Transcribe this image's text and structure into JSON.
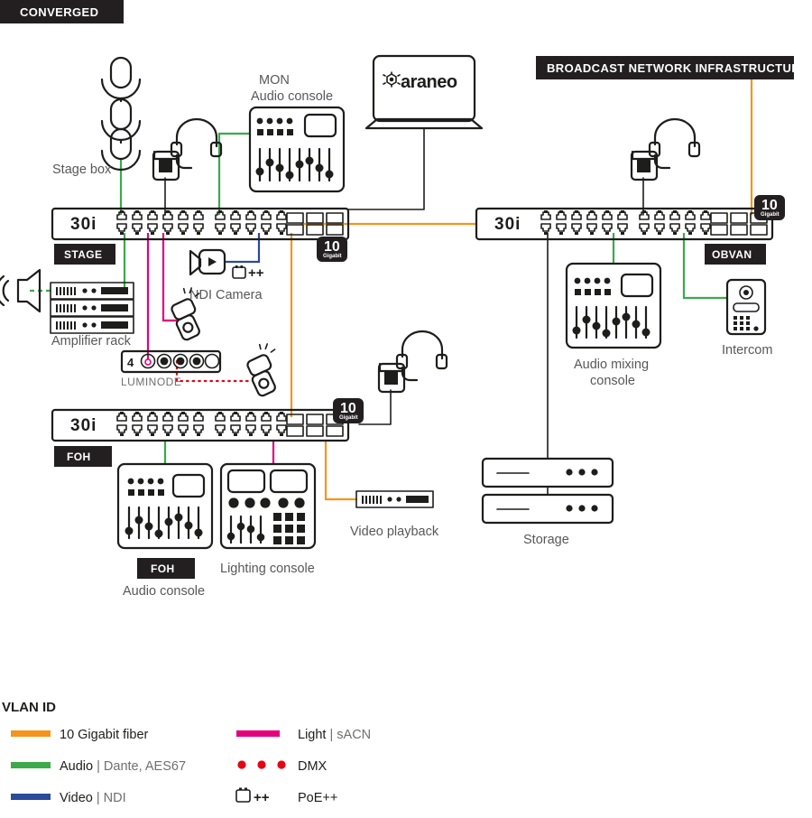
{
  "title_tags": {
    "converged": "CONVERGED",
    "broadcast": "BROADCAST NETWORK INFRASTRUCTURE"
  },
  "switches": [
    {
      "id": "stage",
      "model": "30i",
      "zone": "STAGE",
      "badge_number": "10",
      "badge_unit": "Gigabit"
    },
    {
      "id": "obvan",
      "model": "30i",
      "zone": "OBVAN",
      "badge_number": "10",
      "badge_unit": "Gigabit"
    },
    {
      "id": "foh",
      "model": "30i",
      "zone": "FOH",
      "badge_number": "10",
      "badge_unit": "Gigabit"
    }
  ],
  "devices": {
    "stage_box": "Stage box",
    "mon_console_line1": "MON",
    "mon_console_line2": "Audio console",
    "laptop_brand": "araneo",
    "amplifier_rack": "Amplifier rack",
    "ndi_camera": "NDI Camera",
    "ndi_camera_poe": "++",
    "luminode_label": "LUMINODE",
    "luminode_port_number": "4",
    "foh_audio_zone": "FOH",
    "foh_audio_console": "Audio console",
    "lighting_console": "Lighting console",
    "video_playback": "Video playback",
    "audio_mixing_console_line1": "Audio mixing",
    "audio_mixing_console_line2": "console",
    "intercom": "Intercom",
    "storage": "Storage"
  },
  "legend": {
    "title": "VLAN ID",
    "items": [
      {
        "name": "10 Gigabit fiber",
        "qualifier": "",
        "color": "#F5941D",
        "style": "line",
        "column": 1
      },
      {
        "name": "Audio",
        "qualifier": " | Dante, AES67",
        "color": "#3AAA4A",
        "style": "line",
        "column": 1
      },
      {
        "name": "Video",
        "qualifier": " | NDI",
        "color": "#2B4A9B",
        "style": "line",
        "column": 1
      },
      {
        "name": "Light",
        "qualifier": " | sACN",
        "color": "#E5007D",
        "style": "line",
        "column": 2
      },
      {
        "name": "DMX",
        "qualifier": "",
        "color": "#E30613",
        "style": "dots",
        "column": 2
      },
      {
        "name": "PoE++",
        "qualifier": "",
        "color": "#1d1d1b",
        "style": "poe",
        "column": 2
      }
    ]
  },
  "colors": {
    "fiber_orange": "#F5941D",
    "audio_green": "#3AAA4A",
    "video_blue": "#2B4A9B",
    "light_magenta": "#E5007D",
    "dmx_red": "#E30613",
    "ink": "#1d1d1b",
    "tag_bg": "#231f20",
    "label_grey": "#58585a"
  }
}
